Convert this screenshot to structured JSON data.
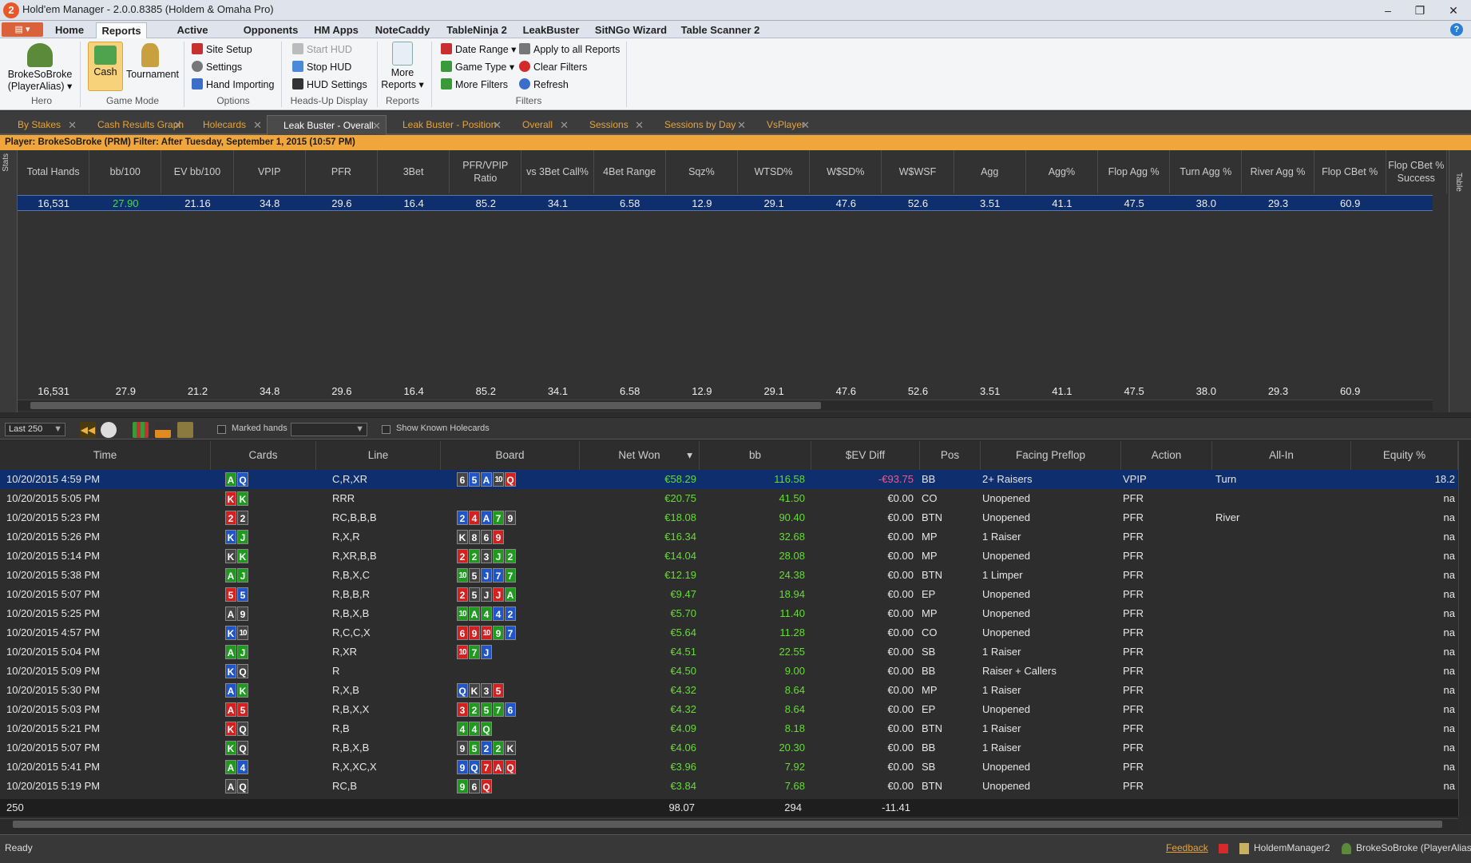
{
  "window": {
    "title": "Hold'em Manager - 2.0.0.8385 (Holdem & Omaha Pro)",
    "app_icon_text": "2",
    "minimize": "–",
    "restore": "❐",
    "close": "✕"
  },
  "menu": {
    "tabs": [
      "Home",
      "Reports",
      "Active Session",
      "Opponents",
      "HM Apps",
      "NoteCaddy",
      "TableNinja 2",
      "LeakBuster",
      "SitNGo Wizard",
      "Table Scanner 2"
    ],
    "active": "Reports",
    "help": "?"
  },
  "ribbon": {
    "hero": {
      "name": "BrokeSoBroke",
      "alias": "(PlayerAlias) ▾",
      "group": "Hero"
    },
    "game_mode": {
      "cash": "Cash",
      "tournament": "Tournament",
      "group": "Game Mode"
    },
    "options": {
      "items": [
        "Site Setup",
        "Settings",
        "Hand Importing"
      ],
      "group": "Options"
    },
    "hud": {
      "items": [
        "Start HUD",
        "Stop HUD",
        "HUD Settings"
      ],
      "group": "Heads-Up Display"
    },
    "reports": {
      "label1": "More",
      "label2": "Reports ▾",
      "group": "Reports"
    },
    "filters": {
      "items": [
        "Date Range ▾",
        "Game Type ▾",
        "More Filters",
        "Apply to all Reports",
        "Clear Filters",
        "Refresh"
      ],
      "group": "Filters"
    }
  },
  "doc_tabs": [
    "By Stakes",
    "Cash Results Graph",
    "Holecards",
    "Leak Buster - Overall",
    "Leak Buster - Position",
    "Overall",
    "Sessions",
    "Sessions by Day",
    "VsPlayer"
  ],
  "active_doc_tab": "Leak Buster - Overall",
  "filter_line": "Player: BrokeSoBroke (PRM)   Filter: After Tuesday, September 1, 2015 (10:57 PM)",
  "stats": {
    "side_label": "Stats",
    "right_label": "Table",
    "columns": [
      "Total Hands",
      "bb/100",
      "EV bb/100",
      "VPIP",
      "PFR",
      "3Bet",
      "PFR/VPIP Ratio",
      "vs 3Bet Call%",
      "4Bet Range",
      "Sqz%",
      "WTSD%",
      "W$SD%",
      "W$WSF",
      "Agg",
      "Agg%",
      "Flop Agg %",
      "Turn Agg %",
      "River Agg %",
      "Flop CBet %",
      "Flop CBet % Success"
    ],
    "row": [
      "16,531",
      "27.90",
      "21.16",
      "34.8",
      "29.6",
      "16.4",
      "85.2",
      "34.1",
      "6.58",
      "12.9",
      "29.1",
      "47.6",
      "52.6",
      "3.51",
      "41.1",
      "47.5",
      "38.0",
      "29.3",
      "60.9",
      ""
    ],
    "total": [
      "16,531",
      "27.9",
      "21.2",
      "34.8",
      "29.6",
      "16.4",
      "85.2",
      "34.1",
      "6.58",
      "12.9",
      "29.1",
      "47.6",
      "52.6",
      "3.51",
      "41.1",
      "47.5",
      "38.0",
      "29.3",
      "60.9",
      ""
    ],
    "bb100_color": "#44dd44"
  },
  "hand_toolbar": {
    "range": "Last 250",
    "marked_label": "Marked hands",
    "show_known": "Show Known Holecards"
  },
  "hands": {
    "columns": [
      "Time",
      "Cards",
      "Line",
      "Board",
      "Net Won",
      "bb",
      "$EV Diff",
      "Pos",
      "Facing Preflop",
      "Action",
      "All-In",
      "Equity %"
    ],
    "sort_indicator": "▾",
    "rows": [
      {
        "time": "10/20/2015 4:59 PM",
        "cards": [
          "A",
          "Q"
        ],
        "line": "C,R,XR",
        "board": [
          "6",
          "5",
          "A",
          "10",
          "Q"
        ],
        "net": "€58.29",
        "bb": "116.58",
        "ev": "-€93.75",
        "pos": "BB",
        "facing": "2+ Raisers",
        "action": "VPIP",
        "allin": "Turn",
        "equity": "18.2"
      },
      {
        "time": "10/20/2015 5:05 PM",
        "cards": [
          "K",
          "K"
        ],
        "line": "RRR",
        "board": [],
        "net": "€20.75",
        "bb": "41.50",
        "ev": "€0.00",
        "pos": "CO",
        "facing": "Unopened",
        "action": "PFR",
        "allin": "",
        "equity": "na"
      },
      {
        "time": "10/20/2015 5:23 PM",
        "cards": [
          "2",
          "2"
        ],
        "line": "RC,B,B,B",
        "board": [
          "2",
          "4",
          "A",
          "7",
          "9"
        ],
        "net": "€18.08",
        "bb": "90.40",
        "ev": "€0.00",
        "pos": "BTN",
        "facing": "Unopened",
        "action": "PFR",
        "allin": "River",
        "equity": "na"
      },
      {
        "time": "10/20/2015 5:26 PM",
        "cards": [
          "K",
          "J"
        ],
        "line": "R,X,R",
        "board": [
          "K",
          "8",
          "6",
          "9"
        ],
        "net": "€16.34",
        "bb": "32.68",
        "ev": "€0.00",
        "pos": "MP",
        "facing": "1 Raiser",
        "action": "PFR",
        "allin": "",
        "equity": "na"
      },
      {
        "time": "10/20/2015 5:14 PM",
        "cards": [
          "K",
          "K"
        ],
        "line": "R,XR,B,B",
        "board": [
          "2",
          "2",
          "3",
          "J",
          "2"
        ],
        "net": "€14.04",
        "bb": "28.08",
        "ev": "€0.00",
        "pos": "MP",
        "facing": "Unopened",
        "action": "PFR",
        "allin": "",
        "equity": "na"
      },
      {
        "time": "10/20/2015 5:38 PM",
        "cards": [
          "A",
          "J"
        ],
        "line": "R,B,X,C",
        "board": [
          "10",
          "5",
          "J",
          "7",
          "7"
        ],
        "net": "€12.19",
        "bb": "24.38",
        "ev": "€0.00",
        "pos": "BTN",
        "facing": "1 Limper",
        "action": "PFR",
        "allin": "",
        "equity": "na"
      },
      {
        "time": "10/20/2015 5:07 PM",
        "cards": [
          "5",
          "5"
        ],
        "line": "R,B,B,R",
        "board": [
          "2",
          "5",
          "J",
          "J",
          "A"
        ],
        "net": "€9.47",
        "bb": "18.94",
        "ev": "€0.00",
        "pos": "EP",
        "facing": "Unopened",
        "action": "PFR",
        "allin": "",
        "equity": "na"
      },
      {
        "time": "10/20/2015 5:25 PM",
        "cards": [
          "A",
          "9"
        ],
        "line": "R,B,X,B",
        "board": [
          "10",
          "A",
          "4",
          "4",
          "2"
        ],
        "net": "€5.70",
        "bb": "11.40",
        "ev": "€0.00",
        "pos": "MP",
        "facing": "Unopened",
        "action": "PFR",
        "allin": "",
        "equity": "na"
      },
      {
        "time": "10/20/2015 4:57 PM",
        "cards": [
          "K",
          "10"
        ],
        "line": "R,C,C,X",
        "board": [
          "6",
          "9",
          "10",
          "9",
          "7"
        ],
        "net": "€5.64",
        "bb": "11.28",
        "ev": "€0.00",
        "pos": "CO",
        "facing": "Unopened",
        "action": "PFR",
        "allin": "",
        "equity": "na"
      },
      {
        "time": "10/20/2015 5:04 PM",
        "cards": [
          "A",
          "J"
        ],
        "line": "R,XR",
        "board": [
          "10",
          "7",
          "J"
        ],
        "net": "€4.51",
        "bb": "22.55",
        "ev": "€0.00",
        "pos": "SB",
        "facing": "1 Raiser",
        "action": "PFR",
        "allin": "",
        "equity": "na"
      },
      {
        "time": "10/20/2015 5:09 PM",
        "cards": [
          "K",
          "Q"
        ],
        "line": "R",
        "board": [],
        "net": "€4.50",
        "bb": "9.00",
        "ev": "€0.00",
        "pos": "BB",
        "facing": "Raiser + Callers",
        "action": "PFR",
        "allin": "",
        "equity": "na"
      },
      {
        "time": "10/20/2015 5:30 PM",
        "cards": [
          "A",
          "K"
        ],
        "line": "R,X,B",
        "board": [
          "Q",
          "K",
          "3",
          "5"
        ],
        "net": "€4.32",
        "bb": "8.64",
        "ev": "€0.00",
        "pos": "MP",
        "facing": "1 Raiser",
        "action": "PFR",
        "allin": "",
        "equity": "na"
      },
      {
        "time": "10/20/2015 5:03 PM",
        "cards": [
          "A",
          "5"
        ],
        "line": "R,B,X,X",
        "board": [
          "3",
          "2",
          "5",
          "7",
          "6"
        ],
        "net": "€4.32",
        "bb": "8.64",
        "ev": "€0.00",
        "pos": "EP",
        "facing": "Unopened",
        "action": "PFR",
        "allin": "",
        "equity": "na"
      },
      {
        "time": "10/20/2015 5:21 PM",
        "cards": [
          "K",
          "Q"
        ],
        "line": "R,B",
        "board": [
          "4",
          "4",
          "Q"
        ],
        "net": "€4.09",
        "bb": "8.18",
        "ev": "€0.00",
        "pos": "BTN",
        "facing": "1 Raiser",
        "action": "PFR",
        "allin": "",
        "equity": "na"
      },
      {
        "time": "10/20/2015 5:07 PM",
        "cards": [
          "K",
          "Q"
        ],
        "line": "R,B,X,B",
        "board": [
          "9",
          "5",
          "2",
          "2",
          "K"
        ],
        "net": "€4.06",
        "bb": "20.30",
        "ev": "€0.00",
        "pos": "BB",
        "facing": "1 Raiser",
        "action": "PFR",
        "allin": "",
        "equity": "na"
      },
      {
        "time": "10/20/2015 5:41 PM",
        "cards": [
          "A",
          "4"
        ],
        "line": "R,X,XC,X",
        "board": [
          "9",
          "Q",
          "7",
          "A",
          "Q"
        ],
        "net": "€3.96",
        "bb": "7.92",
        "ev": "€0.00",
        "pos": "SB",
        "facing": "Unopened",
        "action": "PFR",
        "allin": "",
        "equity": "na"
      },
      {
        "time": "10/20/2015 5:19 PM",
        "cards": [
          "A",
          "Q"
        ],
        "line": "RC,B",
        "board": [
          "9",
          "6",
          "Q"
        ],
        "net": "€3.84",
        "bb": "7.68",
        "ev": "€0.00",
        "pos": "BTN",
        "facing": "Unopened",
        "action": "PFR",
        "allin": "",
        "equity": "na"
      }
    ],
    "card_colors": [
      [
        "g",
        "b"
      ],
      [
        "r",
        "g"
      ],
      [
        "r",
        "k"
      ],
      [
        "b",
        "g"
      ],
      [
        "k",
        "g"
      ],
      [
        "g",
        "g"
      ],
      [
        "r",
        "b"
      ],
      [
        "k",
        "k"
      ],
      [
        "b",
        "k"
      ],
      [
        "g",
        "g"
      ],
      [
        "b",
        "k"
      ],
      [
        "b",
        "g"
      ],
      [
        "r",
        "r"
      ],
      [
        "r",
        "k"
      ],
      [
        "g",
        "k"
      ],
      [
        "g",
        "b"
      ],
      [
        "k",
        "k"
      ]
    ],
    "board_colors": [
      [
        "k",
        "b",
        "b",
        "k",
        "r"
      ],
      [],
      [
        "b",
        "r",
        "b",
        "g",
        "k"
      ],
      [
        "k",
        "k",
        "k",
        "r"
      ],
      [
        "r",
        "g",
        "k",
        "g",
        "g"
      ],
      [
        "g",
        "k",
        "b",
        "b",
        "g"
      ],
      [
        "r",
        "k",
        "k",
        "r",
        "g"
      ],
      [
        "g",
        "g",
        "g",
        "b",
        "b"
      ],
      [
        "r",
        "r",
        "r",
        "g",
        "b"
      ],
      [
        "r",
        "g",
        "b"
      ],
      [],
      [
        "b",
        "k",
        "k",
        "r"
      ],
      [
        "r",
        "g",
        "g",
        "g",
        "b"
      ],
      [
        "g",
        "g",
        "g"
      ],
      [
        "k",
        "g",
        "b",
        "g",
        "k"
      ],
      [
        "b",
        "b",
        "r",
        "r",
        "r"
      ],
      [
        "g",
        "k",
        "r"
      ]
    ],
    "colors": {
      "r": "#d62020",
      "g": "#1f9a1f",
      "b": "#1f55c8",
      "k": "#444444",
      "net": "#66dd33",
      "evneg": "#ee5a8a"
    },
    "total": {
      "count": "250",
      "net": "98.07",
      "bb": "294",
      "ev": "-11.41"
    }
  },
  "status": {
    "left": "Ready",
    "feedback": "Feedback",
    "app": "HoldemManager2",
    "player": "BrokeSoBroke (PlayerAlias)"
  }
}
